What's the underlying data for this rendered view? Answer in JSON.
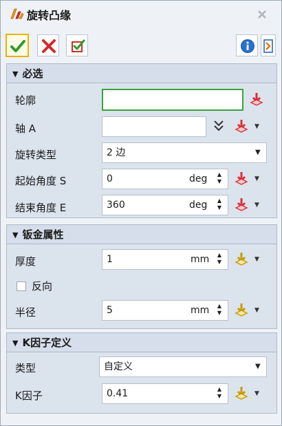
{
  "window": {
    "title": "旋转凸缘",
    "close_icon": "close-icon"
  },
  "toolbar": {
    "ok_icon": "checkmark-icon",
    "cancel_icon": "cross-icon",
    "apply_icon": "checkbox-apply-icon",
    "info_icon": "info-icon",
    "help_icon": "help-icon"
  },
  "sections": {
    "required": {
      "title": "必选",
      "profile_label": "轮廓",
      "profile_value": "",
      "axis_label": "轴 A",
      "axis_value": "",
      "rotation_type_label": "旋转类型",
      "rotation_type_value": "2 边",
      "start_angle_label": "起始角度 S",
      "start_angle_value": "0",
      "start_angle_unit": "deg",
      "end_angle_label": "结束角度 E",
      "end_angle_value": "360",
      "end_angle_unit": "deg"
    },
    "sheet_metal": {
      "title": "钣金属性",
      "thickness_label": "厚度",
      "thickness_value": "1",
      "thickness_unit": "mm",
      "reverse_label": "反向",
      "reverse_checked": false,
      "radius_label": "半径",
      "radius_value": "5",
      "radius_unit": "mm"
    },
    "k_factor": {
      "title": "K因子定义",
      "type_label": "类型",
      "type_value": "自定义",
      "k_label": "K因子",
      "k_value": "0.41"
    }
  },
  "colors": {
    "panel_bg": "#eef2f7",
    "section_bg": "#dbe3ed",
    "active_border": "#3aa33a",
    "ok_border": "#e8b400",
    "pick_red": "#d9303a",
    "pick_yellow": "#e2b400"
  }
}
